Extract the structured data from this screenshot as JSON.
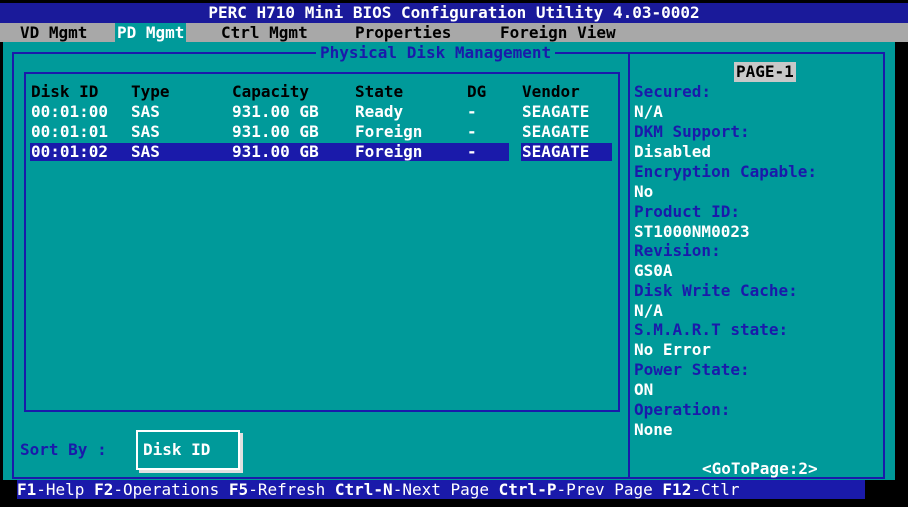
{
  "app": {
    "title": "PERC H710 Mini BIOS Configuration Utility 4.03-0002"
  },
  "menu": [
    {
      "label": "VD Mgmt"
    },
    {
      "label": "PD Mgmt"
    },
    {
      "label": "Ctrl Mgmt"
    },
    {
      "label": "Properties"
    },
    {
      "label": "Foreign View"
    }
  ],
  "panel": {
    "title": "Physical Disk Management"
  },
  "table": {
    "columns": [
      "Disk ID",
      "Type",
      "Capacity",
      "State",
      "DG",
      "Vendor"
    ],
    "rows": [
      [
        "00:01:00",
        "SAS",
        "931.00 GB",
        "Ready",
        "-",
        "SEAGATE"
      ],
      [
        "00:01:01",
        "SAS",
        "931.00 GB",
        "Foreign",
        "-",
        "SEAGATE"
      ],
      [
        "00:01:02",
        "SAS",
        "931.00 GB",
        "Foreign",
        "-",
        "SEAGATE"
      ]
    ],
    "selected_row": 2
  },
  "sort": {
    "label": "Sort By :",
    "value": "Disk ID"
  },
  "properties": {
    "page": "PAGE-1",
    "items": [
      {
        "label": "Secured:",
        "value": "N/A"
      },
      {
        "label": "DKM Support:",
        "value": "Disabled"
      },
      {
        "label": "Encryption Capable:",
        "value": "No"
      },
      {
        "label": "Product ID:",
        "value": "ST1000NM0023"
      },
      {
        "label": "Revision:",
        "value": "GS0A"
      },
      {
        "label": "Disk Write Cache:",
        "value": "N/A"
      },
      {
        "label": "S.M.A.R.T state:",
        "value": "No Error"
      },
      {
        "label": "Power State:",
        "value": "ON"
      },
      {
        "label": "Operation:",
        "value": "None"
      }
    ],
    "goto": "<GoToPage:2>"
  },
  "status": [
    {
      "key": "F1",
      "text": "-Help "
    },
    {
      "key": "F2",
      "text": "-Operations "
    },
    {
      "key": "F5",
      "text": "-Refresh "
    },
    {
      "key": "Ctrl-N",
      "text": "-Next Page "
    },
    {
      "key": "Ctrl-P",
      "text": "-Prev Page "
    },
    {
      "key": "F12",
      "text": "-Ctlr"
    }
  ],
  "colors": {
    "background": "#009a9a",
    "accent": "#1a1aaa",
    "titlebar": "#1a1a9a",
    "menubar": "#a8a8a8"
  }
}
